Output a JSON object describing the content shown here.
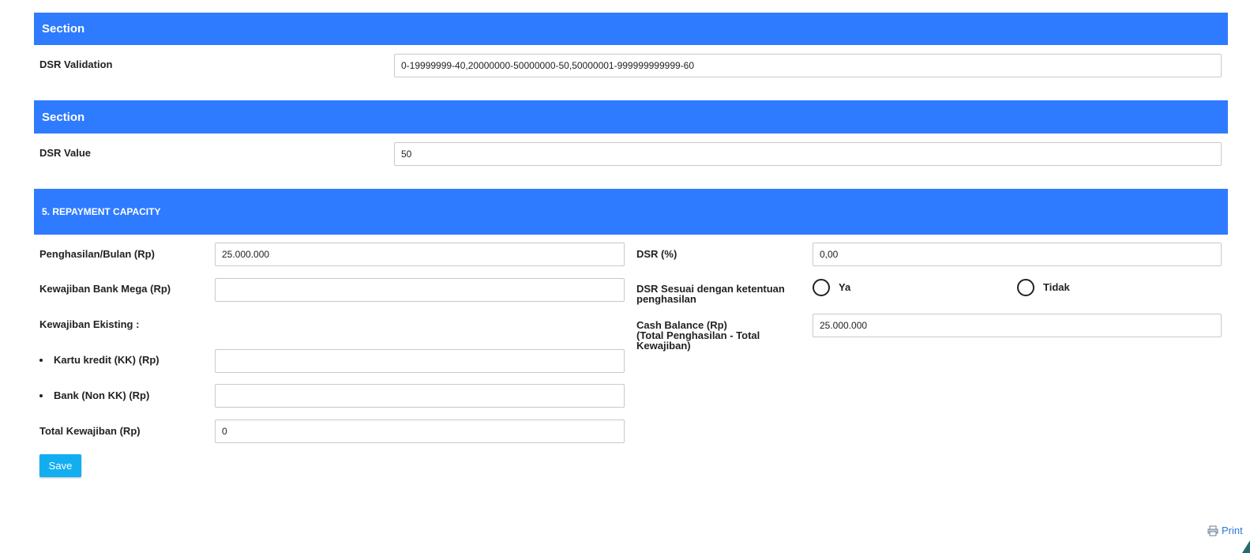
{
  "sections": [
    {
      "title": "Section",
      "field_label": "DSR Validation",
      "field_value": "0-19999999-40,20000000-50000000-50,50000001-999999999999-60"
    },
    {
      "title": "Section",
      "field_label": "DSR Value",
      "field_value": "50"
    }
  ],
  "repayment": {
    "title": "5. REPAYMENT CAPACITY",
    "left": {
      "penghasilan_label": "Penghasilan/Bulan (Rp)",
      "penghasilan_value": "25.000.000",
      "kewajiban_mega_label": "Kewajiban Bank Mega (Rp)",
      "kewajiban_mega_value": "",
      "kewajiban_eksisting_label": "Kewajiban Ekisting :",
      "kartu_kredit_label": "Kartu kredit (KK) (Rp)",
      "kartu_kredit_value": "",
      "bank_non_kk_label": "Bank (Non KK) (Rp)",
      "bank_non_kk_value": "",
      "total_kewajiban_label": "Total Kewajiban (Rp)",
      "total_kewajiban_value": "0"
    },
    "right": {
      "dsr_label": "DSR (%)",
      "dsr_value": "0,00",
      "dsr_sesuai_label_line1": "DSR Sesuai dengan ketentuan",
      "dsr_sesuai_label_line2": "penghasilan",
      "radio_ya": "Ya",
      "radio_tidak": "Tidak",
      "cash_balance_label_line1": "Cash Balance (Rp)",
      "cash_balance_label_line2": "(Total Penghasilan - Total",
      "cash_balance_label_line3": "Kewajiban)",
      "cash_balance_value": "25.000.000"
    },
    "save_label": "Save"
  },
  "footer": {
    "print_label": "Print"
  },
  "colors": {
    "section_header": "#2f7bff",
    "save_button": "#12aef0",
    "link": "#2a7ad6"
  },
  "icons": {
    "print": "printer-icon"
  }
}
